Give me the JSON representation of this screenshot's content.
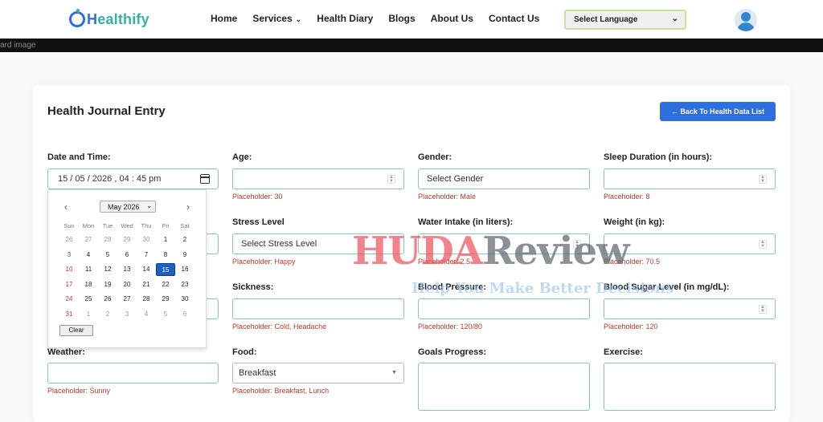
{
  "nav": {
    "logo_part1": "H",
    "logo_part2": "ealthify",
    "items": [
      "Home",
      "Services",
      "Health Diary",
      "Blogs",
      "About Us",
      "Contact Us"
    ],
    "language": "Select Language"
  },
  "banner_alt": "ard image",
  "page": {
    "title": "Health Journal Entry",
    "back_button": "← Back To Health Data List"
  },
  "fields": {
    "datetime": {
      "label": "Date and Time:",
      "value": "15 / 05 / 2026 ,  04 : 45   pm"
    },
    "age": {
      "label": "Age:",
      "placeholder": "Placeholder: 30"
    },
    "gender": {
      "label": "Gender:",
      "value": "Select Gender",
      "placeholder": "Placeholder: Male"
    },
    "sleep": {
      "label": "Sleep Duration (in hours):",
      "placeholder": "Placeholder: 8"
    },
    "stress": {
      "label": "Stress Level",
      "value": "Select Stress Level",
      "placeholder": "Placeholder: Happy"
    },
    "water": {
      "label": "Water Intake (in liters):",
      "placeholder": "Placeholder: 2.5"
    },
    "weight": {
      "label": "Weight (in kg):",
      "placeholder": "Placeholder: 70.5"
    },
    "sickness": {
      "label": "Sickness:",
      "placeholder": "Placeholder: Cold, Headache"
    },
    "bp": {
      "label": "Blood Pressure:",
      "placeholder": "Placeholder: 120/80"
    },
    "sugar": {
      "label": "Blood Sugar Level (in mg/dL):",
      "placeholder": "Placeholder: 120"
    },
    "weather": {
      "label": "Weather:",
      "placeholder": "Placeholder: Sunny"
    },
    "food": {
      "label": "Food:",
      "value": "Breakfast",
      "placeholder": "Placeholder: Breakfast, Lunch"
    },
    "goals": {
      "label": "Goals Progress:"
    },
    "exercise": {
      "label": "Exercise:"
    }
  },
  "datepicker": {
    "month": "May 2026",
    "prev": "‹",
    "next": "›",
    "dow": [
      "Sun",
      "Mon",
      "Tue",
      "Wed",
      "Thu",
      "Fri",
      "Sat"
    ],
    "weeks": [
      [
        "26",
        "27",
        "28",
        "29",
        "30",
        "1",
        "2"
      ],
      [
        "3",
        "4",
        "5",
        "6",
        "7",
        "8",
        "9"
      ],
      [
        "10",
        "11",
        "12",
        "13",
        "14",
        "15",
        "16"
      ],
      [
        "17",
        "18",
        "19",
        "20",
        "21",
        "22",
        "23"
      ],
      [
        "24",
        "25",
        "26",
        "27",
        "28",
        "29",
        "30"
      ],
      [
        "31",
        "1",
        "2",
        "3",
        "4",
        "5",
        "6"
      ]
    ],
    "selected": "15",
    "clear": "Clear"
  },
  "watermark": {
    "huda": "HUDA",
    "review": "Review",
    "tagline": "Help You Make Better Decisions"
  }
}
